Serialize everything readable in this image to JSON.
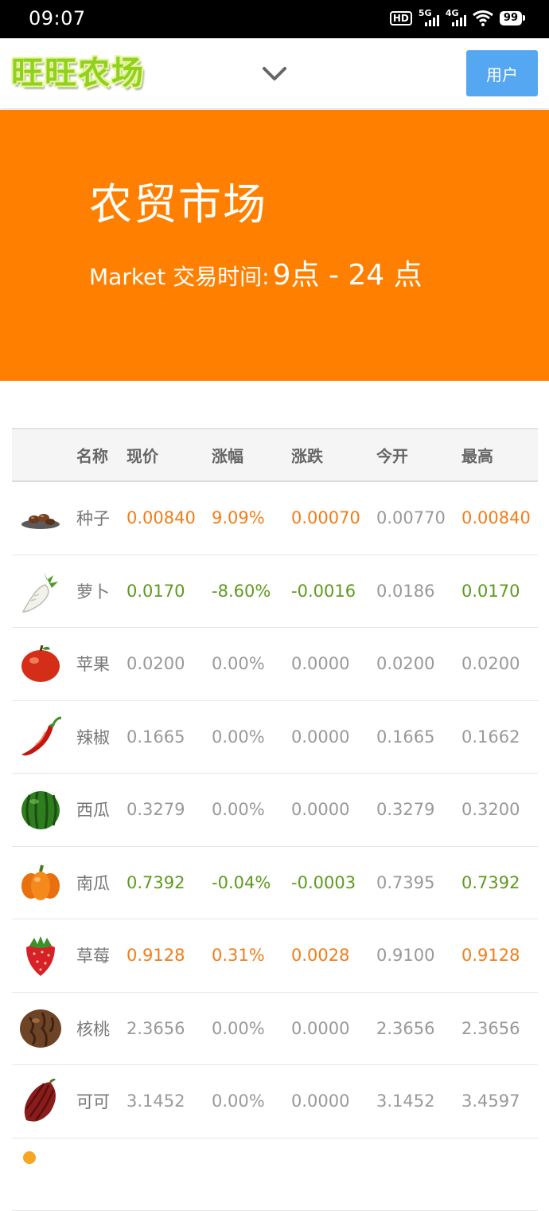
{
  "status_bar": {
    "time": "09:07",
    "hd_label": "HD",
    "net1_label": "5G",
    "net2_label": "4G",
    "battery": "99"
  },
  "header": {
    "logo_text": "旺旺农场",
    "user_button": "用户",
    "icons": {
      "dropdown": "chevron-down-icon"
    }
  },
  "banner": {
    "title": "农贸市场",
    "subtitle_prefix": "Market 交易时间:",
    "hours": "9点 - 24 点",
    "color": "#ff8001"
  },
  "colors": {
    "up": "#f27d17",
    "down": "#5f9a1f",
    "neutral": "#999999",
    "button": "#56a7f1"
  },
  "table": {
    "headers": {
      "name": "名称",
      "price": "现价",
      "change": "涨幅",
      "diff": "涨跌",
      "open": "今开",
      "high": "最高"
    },
    "rows": [
      {
        "icon": "seed-icon",
        "name": "种子",
        "price": "0.00840",
        "change": "9.09%",
        "diff": "0.00070",
        "open": "0.00770",
        "high": "0.00840",
        "trend": "up"
      },
      {
        "icon": "radish-icon",
        "name": "萝卜",
        "price": "0.0170",
        "change": "-8.60%",
        "diff": "-0.0016",
        "open": "0.0186",
        "high": "0.0170",
        "trend": "down"
      },
      {
        "icon": "apple-icon",
        "name": "苹果",
        "price": "0.0200",
        "change": "0.00%",
        "diff": "0.0000",
        "open": "0.0200",
        "high": "0.0200",
        "trend": "flat"
      },
      {
        "icon": "chili-icon",
        "name": "辣椒",
        "price": "0.1665",
        "change": "0.00%",
        "diff": "0.0000",
        "open": "0.1665",
        "high": "0.1662",
        "trend": "flat"
      },
      {
        "icon": "watermelon-icon",
        "name": "西瓜",
        "price": "0.3279",
        "change": "0.00%",
        "diff": "0.0000",
        "open": "0.3279",
        "high": "0.3200",
        "trend": "flat"
      },
      {
        "icon": "pumpkin-icon",
        "name": "南瓜",
        "price": "0.7392",
        "change": "-0.04%",
        "diff": "-0.0003",
        "open": "0.7395",
        "high": "0.7392",
        "trend": "down"
      },
      {
        "icon": "strawberry-icon",
        "name": "草莓",
        "price": "0.9128",
        "change": "0.31%",
        "diff": "0.0028",
        "open": "0.9100",
        "high": "0.9128",
        "trend": "up"
      },
      {
        "icon": "walnut-icon",
        "name": "核桃",
        "price": "2.3656",
        "change": "0.00%",
        "diff": "0.0000",
        "open": "2.3656",
        "high": "2.3656",
        "trend": "flat"
      },
      {
        "icon": "cacao-icon",
        "name": "可可",
        "price": "3.1452",
        "change": "0.00%",
        "diff": "0.0000",
        "open": "3.1452",
        "high": "3.4597",
        "trend": "flat"
      }
    ]
  }
}
